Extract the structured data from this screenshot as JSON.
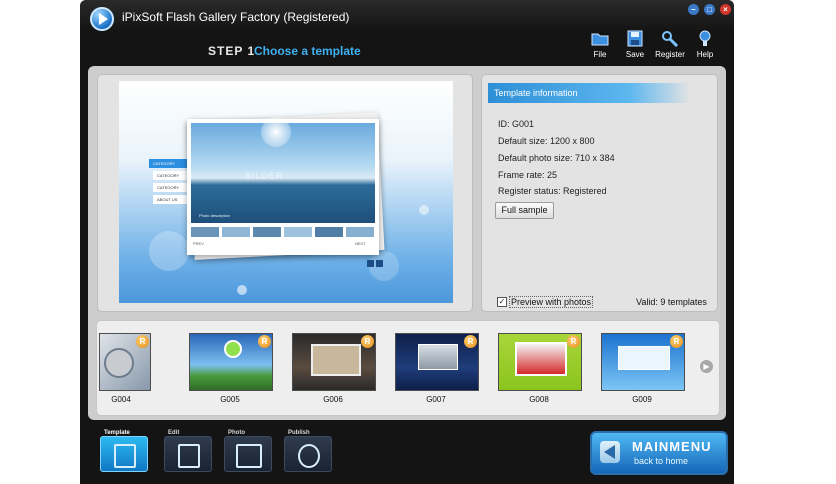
{
  "window": {
    "title": "iPixSoft Flash Gallery Factory (Registered)",
    "controls": {
      "minimize": "–",
      "maximize": "□",
      "close": "×"
    }
  },
  "header": {
    "step_label": "STEP 1",
    "step_title": "Choose a template"
  },
  "toolbar": [
    {
      "label": "File",
      "icon": "folder-icon"
    },
    {
      "label": "Save",
      "icon": "floppy-icon"
    },
    {
      "label": "Register",
      "icon": "wrench-icon"
    },
    {
      "label": "Help",
      "icon": "lightbulb-icon"
    }
  ],
  "preview": {
    "menu_items": [
      "CATEGORY",
      "CATEGORY",
      "CATEGORY",
      "ABOUT US"
    ],
    "watermark": "BILDER",
    "caption": "Photo description",
    "prev_label": "PREV",
    "next_label": "NEXT"
  },
  "template_info": {
    "header": "Template information",
    "lines": [
      "ID: G001",
      "Default size: 1200 x 800",
      "Default photo size: 710 x 384",
      "Frame rate: 25",
      "Register status: Registered"
    ],
    "full_sample_label": "Full sample",
    "preview_with_photos_label": "Preview with photos",
    "preview_with_photos_checked": true,
    "checkmark": "✓",
    "valid_text": "Valid: 9 templates"
  },
  "thumbnails": [
    {
      "label": "G004",
      "colors": [
        "#c9cfd6",
        "#6f8aa3"
      ]
    },
    {
      "label": "G005",
      "colors": [
        "#2a66b8",
        "#7cc0ef"
      ]
    },
    {
      "label": "G006",
      "colors": [
        "#3a3a3a",
        "#8c7a66"
      ]
    },
    {
      "label": "G007",
      "colors": [
        "#0e1f4a",
        "#5a7cc2"
      ]
    },
    {
      "label": "G008",
      "colors": [
        "#9ccd2a",
        "#d42a2a"
      ]
    },
    {
      "label": "G009",
      "colors": [
        "#1c73cf",
        "#7cc6f5"
      ]
    }
  ],
  "thumb_badge": "R",
  "strip_arrows": {
    "left": "◀",
    "right": "▶"
  },
  "bottom_nav": [
    {
      "label": "Template",
      "active": true
    },
    {
      "label": "Edit",
      "active": false
    },
    {
      "label": "Photo",
      "active": false
    },
    {
      "label": "Publish",
      "active": false
    }
  ],
  "main_menu": {
    "title": "MAINMENU",
    "subtitle": "back to home"
  },
  "colors": {
    "accent": "#3fb0f0",
    "window_bg": "#141414",
    "panel_bg": "#cdcdcd"
  }
}
